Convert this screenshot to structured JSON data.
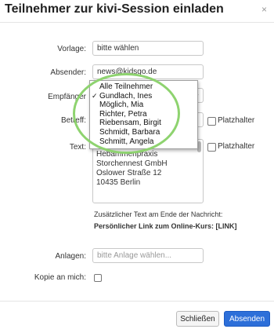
{
  "dialog": {
    "title": "Teilnehmer zur kivi-Session einladen",
    "close_glyph": "×"
  },
  "form": {
    "vorlage": {
      "label": "Vorlage:",
      "value": "bitte wählen"
    },
    "absender": {
      "label": "Absender:",
      "value": "news@kidsgo.de"
    },
    "empfaenger": {
      "label": "Empfänger",
      "options": [
        {
          "label": "Alle Teilnehmer",
          "checked": false
        },
        {
          "label": "Gundlach, Ines",
          "checked": true
        },
        {
          "label": "Möglich, Mia",
          "checked": false
        },
        {
          "label": "Richter, Petra",
          "checked": false
        },
        {
          "label": "Riebensam, Birgit",
          "checked": false
        },
        {
          "label": "Schmidt, Barbara",
          "checked": false
        },
        {
          "label": "Schmitt, Angela",
          "checked": false
        }
      ],
      "check_glyph": "✓"
    },
    "betreff": {
      "label": "Betreff:",
      "placeholder_label": "Platzhalter"
    },
    "text": {
      "label": "Text:",
      "placeholder_label": "Platzhalter",
      "lines": [
        "Hebammenpraxis",
        "Storchennest GmbH",
        "Oslower Straße 12",
        "10435 Berlin"
      ]
    },
    "additional_text": {
      "line1": "Zusätzlicher Text am Ende der Nachricht:",
      "line2": "Persönlicher Link zum Online-Kurs: [LINK]"
    },
    "anlagen": {
      "label": "Anlagen:",
      "placeholder": "bitte Anlage wählen..."
    },
    "kopie": {
      "label": "Kopie an mich:",
      "checked": false
    }
  },
  "footer": {
    "close_button": "Schließen",
    "send_button": "Absenden"
  },
  "colors": {
    "primary": "#2d6fd9",
    "highlight_ring": "#8ed36f"
  }
}
